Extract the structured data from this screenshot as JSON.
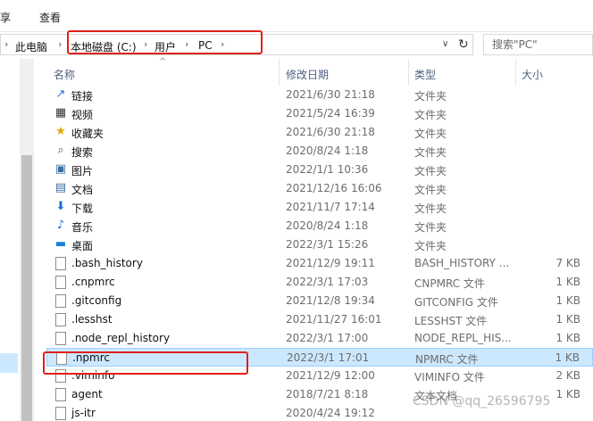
{
  "ribbon": {
    "share_tab": "共享",
    "view_tab": "查看"
  },
  "address": {
    "crumbs": [
      "此电脑",
      "本地磁盘 (C:)",
      "用户",
      "PC"
    ],
    "search_placeholder": "搜索\"PC\""
  },
  "columns": {
    "name": "名称",
    "date": "修改日期",
    "type": "类型",
    "size": "大小"
  },
  "files": [
    {
      "name": "链接",
      "date": "2021/6/30 21:18",
      "type": "文件夹",
      "size": "",
      "icon": "link-folder-icon"
    },
    {
      "name": "视频",
      "date": "2021/5/24 16:39",
      "type": "文件夹",
      "size": "",
      "icon": "video-folder-icon"
    },
    {
      "name": "收藏夹",
      "date": "2021/6/30 21:18",
      "type": "文件夹",
      "size": "",
      "icon": "favorites-folder-icon"
    },
    {
      "name": "搜索",
      "date": "2020/8/24 1:18",
      "type": "文件夹",
      "size": "",
      "icon": "search-folder-icon"
    },
    {
      "name": "图片",
      "date": "2022/1/1 10:36",
      "type": "文件夹",
      "size": "",
      "icon": "pictures-folder-icon"
    },
    {
      "name": "文档",
      "date": "2021/12/16 16:06",
      "type": "文件夹",
      "size": "",
      "icon": "documents-folder-icon"
    },
    {
      "name": "下载",
      "date": "2021/11/7 17:14",
      "type": "文件夹",
      "size": "",
      "icon": "downloads-folder-icon"
    },
    {
      "name": "音乐",
      "date": "2020/8/24 1:18",
      "type": "文件夹",
      "size": "",
      "icon": "music-folder-icon"
    },
    {
      "name": "桌面",
      "date": "2022/3/1 15:26",
      "type": "文件夹",
      "size": "",
      "icon": "desktop-folder-icon"
    },
    {
      "name": ".bash_history",
      "date": "2021/12/9 19:11",
      "type": "BASH_HISTORY ...",
      "size": "7 KB",
      "icon": "file-icon"
    },
    {
      "name": ".cnpmrc",
      "date": "2022/3/1 17:03",
      "type": "CNPMRC 文件",
      "size": "1 KB",
      "icon": "file-icon"
    },
    {
      "name": ".gitconfig",
      "date": "2021/12/8 19:34",
      "type": "GITCONFIG 文件",
      "size": "1 KB",
      "icon": "file-icon"
    },
    {
      "name": ".lesshst",
      "date": "2021/11/27 16:01",
      "type": "LESSHST 文件",
      "size": "1 KB",
      "icon": "file-icon"
    },
    {
      "name": ".node_repl_history",
      "date": "2022/3/1 17:00",
      "type": "NODE_REPL_HIS...",
      "size": "1 KB",
      "icon": "file-icon"
    },
    {
      "name": ".npmrc",
      "date": "2022/3/1 17:01",
      "type": "NPMRC 文件",
      "size": "1 KB",
      "icon": "file-icon",
      "selected": true
    },
    {
      "name": ".viminfo",
      "date": "2021/12/9 12:00",
      "type": "VIMINFO 文件",
      "size": "2 KB",
      "icon": "file-icon"
    },
    {
      "name": "agent",
      "date": "2018/7/21 8:18",
      "type": "文本文档",
      "size": "1 KB",
      "icon": "text-file-icon"
    },
    {
      "name": "js-itr",
      "date": "2020/4/24 19:12",
      "type": "",
      "size": "",
      "icon": "file-icon"
    }
  ],
  "watermark": "CSDN @qq_26596795",
  "colors": {
    "selection": "#cce8ff",
    "annotation_red": "#e0201c"
  }
}
